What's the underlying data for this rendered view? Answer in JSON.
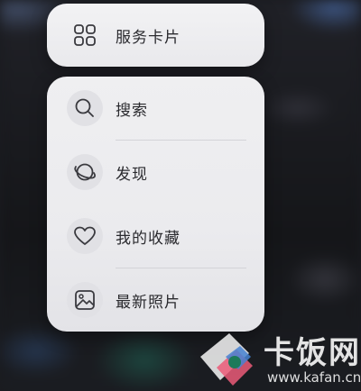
{
  "service_card": {
    "label": "服务卡片",
    "icon": "grid-icon"
  },
  "menu": {
    "items": [
      {
        "label": "搜索",
        "icon": "search-icon"
      },
      {
        "label": "发现",
        "icon": "planet-icon"
      },
      {
        "label": "我的收藏",
        "icon": "heart-icon"
      },
      {
        "label": "最新照片",
        "icon": "image-icon"
      }
    ]
  },
  "watermark": {
    "text": "卡饭网",
    "url": "www.kafan.cn"
  }
}
